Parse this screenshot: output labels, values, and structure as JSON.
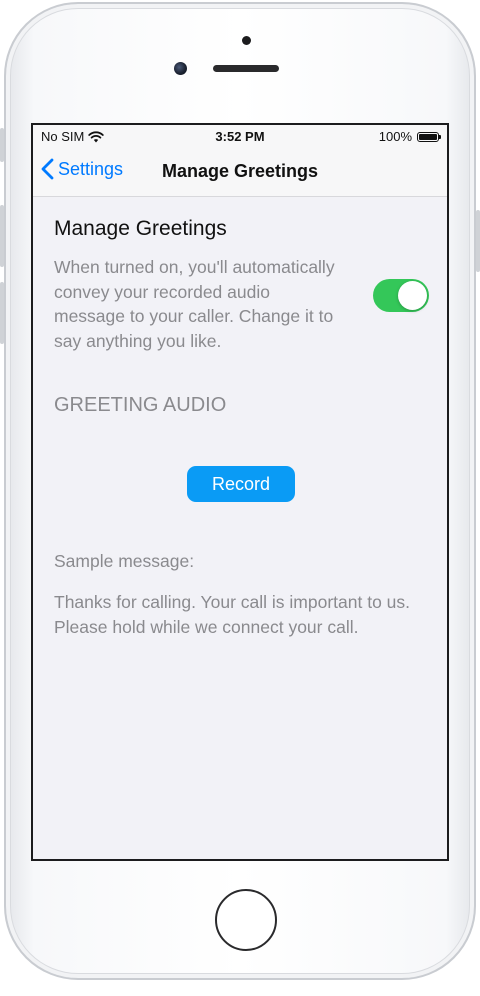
{
  "status_bar": {
    "carrier": "No SIM",
    "time": "3:52 PM",
    "battery_percent": "100%",
    "battery_level": 1.0
  },
  "nav": {
    "back_label": "Settings",
    "title": "Manage Greetings"
  },
  "main": {
    "section_title": "Manage Greetings",
    "description": "When turned on, you'll automatically convey your recorded audio message to your caller. Change it to say anything you like.",
    "toggle_on": true,
    "greeting_audio_label": "GREETING AUDIO",
    "record_label": "Record",
    "sample_label": "Sample message:",
    "sample_text": "Thanks for calling. Your call is important to us. Please hold while we connect your call."
  },
  "colors": {
    "accent": "#007aff",
    "toggle_on": "#34c759",
    "record_button": "#0a9bf5",
    "secondary_text": "#8a8a8e",
    "background": "#f2f2f7"
  }
}
